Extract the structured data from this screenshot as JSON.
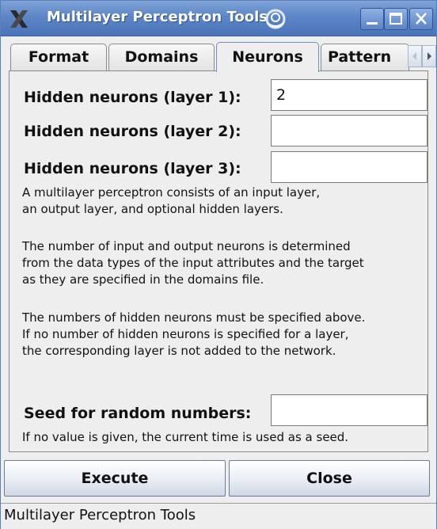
{
  "window": {
    "title": "Multilayer Perceptron Tools"
  },
  "tabs": [
    {
      "label": "Format",
      "selected": false
    },
    {
      "label": "Domains",
      "selected": false
    },
    {
      "label": "Neurons",
      "selected": true
    },
    {
      "label": "Pattern",
      "selected": false
    }
  ],
  "fields": {
    "hidden1": {
      "label": "Hidden neurons (layer 1):",
      "value": "2"
    },
    "hidden2": {
      "label": "Hidden neurons (layer 2):",
      "value": ""
    },
    "hidden3": {
      "label": "Hidden neurons (layer 3):",
      "value": ""
    },
    "seed": {
      "label": "Seed for random numbers:",
      "value": ""
    }
  },
  "descriptions": {
    "p1": "A multilayer perceptron consists of an input layer,\nan output layer, and optional hidden layers.",
    "p2": "The number of input and output neurons is determined\nfrom the data types of the input attributes and the target\nas they are specified in the domains file.",
    "p3": "The numbers of hidden neurons must be specified above.\nIf no number of hidden neurons is specified for a layer,\nthe corresponding layer is not added to the network.",
    "seed_hint": "If no value is given, the current time is used as a seed."
  },
  "buttons": {
    "execute": "Execute",
    "close": "Close"
  },
  "status": "Multilayer Perceptron Tools",
  "icons": {
    "app": "x-logo-icon",
    "ornament": "swirl-icon",
    "minimize": "minimize-icon",
    "maximize": "maximize-icon",
    "close": "close-icon",
    "tab_left": "arrow-left-icon",
    "tab_right": "arrow-right-icon"
  },
  "colors": {
    "titlebar": "#5d86c7",
    "window_bg": "#eeeeee",
    "tab_active_border": "#6d8fc6"
  }
}
